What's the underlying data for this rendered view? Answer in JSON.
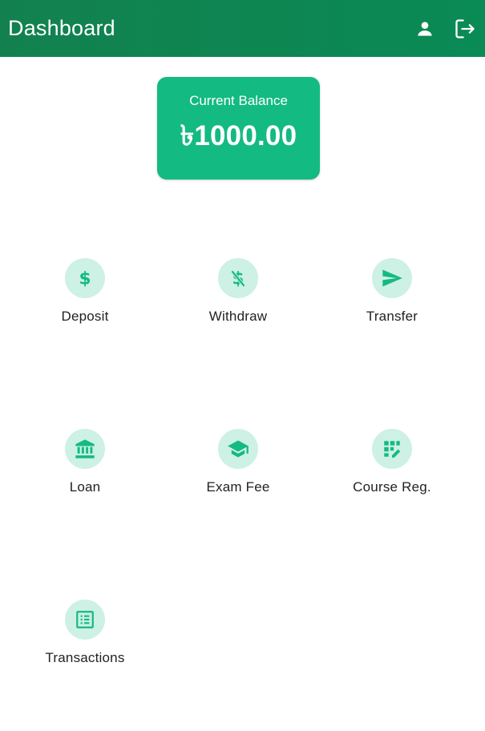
{
  "appbar": {
    "title": "Dashboard",
    "profile_icon": "person-icon",
    "logout_icon": "logout-icon",
    "color": "#0b8551"
  },
  "balance": {
    "label": "Current Balance",
    "value": "৳1000.00",
    "color": "#13ba82"
  },
  "menu": {
    "items": [
      {
        "label": "Deposit",
        "icon": "dollar-icon"
      },
      {
        "label": "Withdraw",
        "icon": "money-off-icon"
      },
      {
        "label": "Transfer",
        "icon": "send-icon"
      },
      {
        "label": "Loan",
        "icon": "bank-icon"
      },
      {
        "label": "Exam Fee",
        "icon": "school-icon"
      },
      {
        "label": "Course Reg.",
        "icon": "app-registration-icon"
      },
      {
        "label": "Transactions",
        "icon": "list-alt-icon"
      }
    ],
    "icon_color": "#13ba82",
    "icon_bg": "#cdf1e4"
  }
}
